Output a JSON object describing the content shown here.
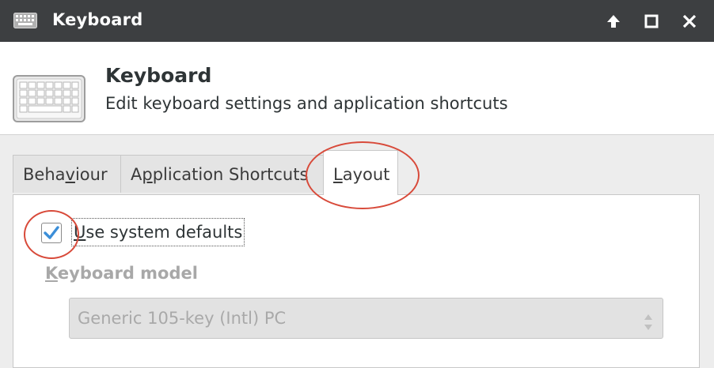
{
  "window": {
    "title": "Keyboard",
    "app_icon": "keyboard-icon",
    "controls": [
      "arrow-up-icon",
      "maximize-icon",
      "close-icon"
    ]
  },
  "header": {
    "title": "Keyboard",
    "subtitle": "Edit keyboard settings and application shortcuts",
    "icon": "keyboard-icon"
  },
  "tabs": [
    {
      "label": "Behaviour",
      "mnemonic": "v",
      "selected": false
    },
    {
      "label": "Application Shortcuts",
      "mnemonic": "p",
      "selected": false
    },
    {
      "label": "Layout",
      "mnemonic": "L",
      "selected": true
    }
  ],
  "layout_tab": {
    "use_defaults": {
      "label": "Use system defaults",
      "mnemonic": "U",
      "checked": true
    },
    "keyboard_model": {
      "label": "Keyboard model",
      "mnemonic": "K",
      "selected": "Generic 105-key (Intl) PC",
      "disabled": true
    }
  },
  "colors": {
    "titlebar": "#3d3f41",
    "check_accent": "#3b8ed8",
    "annotation": "#d84a3a"
  }
}
